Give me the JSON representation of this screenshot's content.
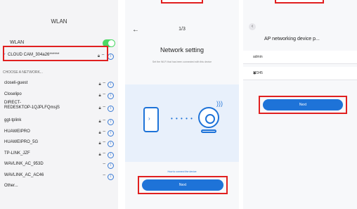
{
  "wlan_screen": {
    "title": "WLAN",
    "wlan_label": "WLAN",
    "connected_network": "CLOUD CAM_304a26******",
    "section_header": "CHOOSE A NETWORK...",
    "networks": [
      {
        "name": "closeli-guest"
      },
      {
        "name": "Closelipo"
      },
      {
        "name": "DIRECT-\nREDESKTOP-1QJPLFQmsjS"
      },
      {
        "name": "ggt-tplink"
      },
      {
        "name": "HUAWEIPRO"
      },
      {
        "name": "HUAWEIPRO_5G"
      },
      {
        "name": "TP-LINK_JZF"
      },
      {
        "name": "WAVLINK_AC_953D"
      },
      {
        "name": "WAVLINK_AC_AC46"
      },
      {
        "name": "Other..."
      }
    ],
    "accent_color": "#3a7bd5",
    "toggle_color": "#4cd964"
  },
  "network_setting_screen": {
    "back_icon": "back-arrow-icon",
    "step": "1/3",
    "title": "Network setting",
    "description": "Set the Wi-Fi that has been connected with this device",
    "help_link": "How to connect the device",
    "next_label": "Next",
    "accent_color": "#1e73d8"
  },
  "ap_screen": {
    "title": "AP networking device p...",
    "username_value": "admin",
    "password_value": "12345",
    "next_label": "Next",
    "accent_color": "#1e73d8"
  },
  "highlight_color": "#e02020"
}
